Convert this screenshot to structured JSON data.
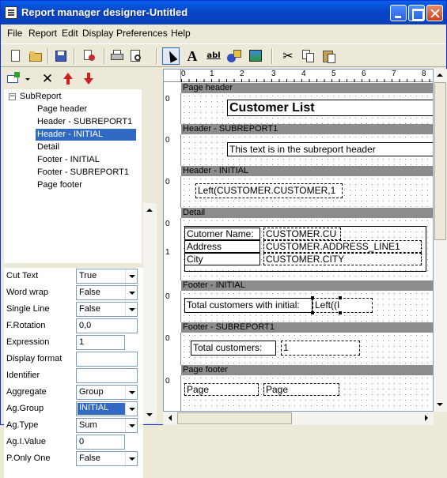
{
  "window": {
    "title": "Report manager designer-Untitled"
  },
  "menu": [
    "File",
    "Report",
    "Edit",
    "Display",
    "Preferences",
    "Help"
  ],
  "toolbar_icons": [
    "new-icon",
    "open-icon",
    "save-icon",
    "print-setup-icon",
    "print-icon",
    "preview-icon",
    "pointer-icon",
    "text-tool-icon",
    "field-tool-icon",
    "shape-tool-icon",
    "image-tool-icon",
    "cut-icon",
    "copy-icon",
    "paste-icon"
  ],
  "tree": {
    "root": "SubReport",
    "items": [
      "Page header",
      "Header - SUBREPORT1",
      "Header - INITIAL",
      "Detail",
      "Footer - INITIAL",
      "Footer - SUBREPORT1",
      "Page footer"
    ],
    "selected_index": 2
  },
  "properties": [
    {
      "label": "Cut Text",
      "value": "True",
      "kind": "dropdown"
    },
    {
      "label": "Word wrap",
      "value": "False",
      "kind": "dropdown"
    },
    {
      "label": "Single Line",
      "value": "False",
      "kind": "dropdown"
    },
    {
      "label": "F.Rotation",
      "value": "0,0",
      "kind": "text"
    },
    {
      "label": "Expression",
      "value": "1",
      "kind": "ellipsis"
    },
    {
      "label": "Display format",
      "value": "",
      "kind": "text"
    },
    {
      "label": "Identifier",
      "value": "",
      "kind": "text"
    },
    {
      "label": "Aggregate",
      "value": "Group",
      "kind": "dropdown"
    },
    {
      "label": "Ag.Group",
      "value": "INITIAL",
      "kind": "dropdown-selected"
    },
    {
      "label": "Ag.Type",
      "value": "Sum",
      "kind": "dropdown"
    },
    {
      "label": "Ag.I.Value",
      "value": "0",
      "kind": "ellipsis"
    },
    {
      "label": "P.Only One",
      "value": "False",
      "kind": "dropdown"
    }
  ],
  "ruler": [
    "0",
    "1",
    "2",
    "3",
    "4",
    "5",
    "6",
    "7",
    "8"
  ],
  "sections": {
    "page_header": {
      "title": "Page header",
      "label": "Customer List"
    },
    "header_sub": {
      "title": "Header - SUBREPORT1",
      "label": "This text is in the subreport header"
    },
    "header_initial": {
      "title": "Header - INITIAL",
      "expr": "Left(CUSTOMER.CUSTOMER,1"
    },
    "detail": {
      "title": "Detail",
      "l1": "Cutomer Name:",
      "l2": "Address",
      "l3": "City",
      "e1": "CUSTOMER.CU",
      "e2": "CUSTOMER.ADDRESS_LINE1",
      "e3": "CUSTOMER.CITY"
    },
    "footer_initial": {
      "title": "Footer - INITIAL",
      "label": "Total customers with initial:",
      "expr": "Left((I"
    },
    "footer_sub": {
      "title": "Footer - SUBREPORT1",
      "label": "Total customers:",
      "expr": "1"
    },
    "page_footer": {
      "title": "Page footer",
      "label": "Page",
      "expr": "Page"
    }
  },
  "vruler": {
    "zero": "0",
    "one": "1"
  }
}
